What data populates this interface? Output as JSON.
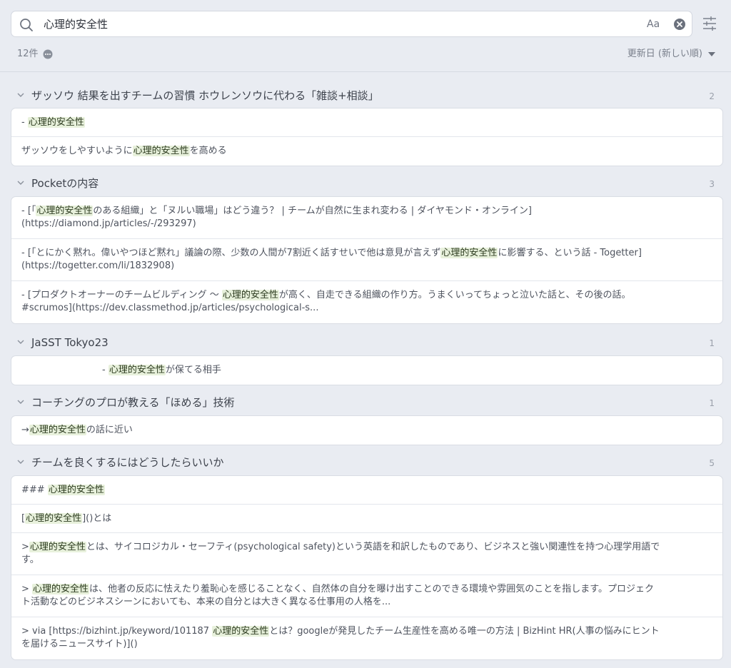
{
  "search": {
    "query": "心理的安全性",
    "case_label": "Aa"
  },
  "summary": {
    "count": "12件",
    "sort_label": "更新日 (新しい順)"
  },
  "highlight": "心理的安全性",
  "groups": [
    {
      "title": "ザッソウ 結果を出すチームの習慣 ホウレンソウに代わる「雑談+相談」",
      "count": "2",
      "rows": [
        {
          "lines": [
            "- 心理的安全性"
          ]
        },
        {
          "lines": [
            "ザッソウをしやすいように心理的安全性を高める"
          ]
        }
      ]
    },
    {
      "title": "Pocketの内容",
      "count": "3",
      "rows": [
        {
          "lines": [
            "- [「心理的安全性のある組織」と「ヌルい職場」はどう違う？ | チームが自然に生まれ変わる | ダイヤモンド・オンライン]",
            "(https://diamond.jp/articles/-/293297)"
          ]
        },
        {
          "lines": [
            "- [「とにかく黙れ。偉いやつほど黙れ」議論の際、少数の人間が7割近く話すせいで他は意見が言えず心理的安全性に影響する、という話 - Togetter]",
            "(https://togetter.com/li/1832908)"
          ]
        },
        {
          "lines": [
            "- [プロダクトオーナーのチームビルディング 〜 心理的安全性が高く、自走できる組織の作り方。うまくいってちょっと泣いた話と、その後の話。",
            "#scrumos](https://dev.classmethod.jp/articles/psychological-s..."
          ]
        }
      ]
    },
    {
      "title": "JaSST Tokyo23",
      "count": "1",
      "rows": [
        {
          "lines": [
            "- 心理的安全性が保てる相手"
          ],
          "indent": true
        }
      ]
    },
    {
      "title": "コーチングのプロが教える「ほめる」技術",
      "count": "1",
      "rows": [
        {
          "lines": [
            "→心理的安全性の話に近い"
          ]
        }
      ]
    },
    {
      "title": "チームを良くするにはどうしたらいいか",
      "count": "5",
      "rows": [
        {
          "lines": [
            "### 心理的安全性"
          ]
        },
        {
          "lines": [
            "[心理的安全性]()とは"
          ]
        },
        {
          "lines": [
            ">心理的安全性とは、サイコロジカル・セーフティ(psychological safety)という英語を和訳したものであり、ビジネスと強い関連性を持つ心理学用語で",
            "す。"
          ]
        },
        {
          "lines": [
            "> 心理的安全性は、他者の反応に怯えたり羞恥心を感じることなく、自然体の自分を曝け出すことのできる環境や雰囲気のことを指します。プロジェク",
            "ト活動などのビジネスシーンにおいても、本来の自分とは大きく異なる仕事用の人格を..."
          ]
        },
        {
          "lines": [
            "> via [https://bizhint.jp/keyword/101187 心理的安全性とは？googleが発見したチーム生産性を高める唯一の方法 | BizHint HR(人事の悩みにヒント",
            "を届けるニュースサイト)]()"
          ]
        }
      ]
    }
  ]
}
